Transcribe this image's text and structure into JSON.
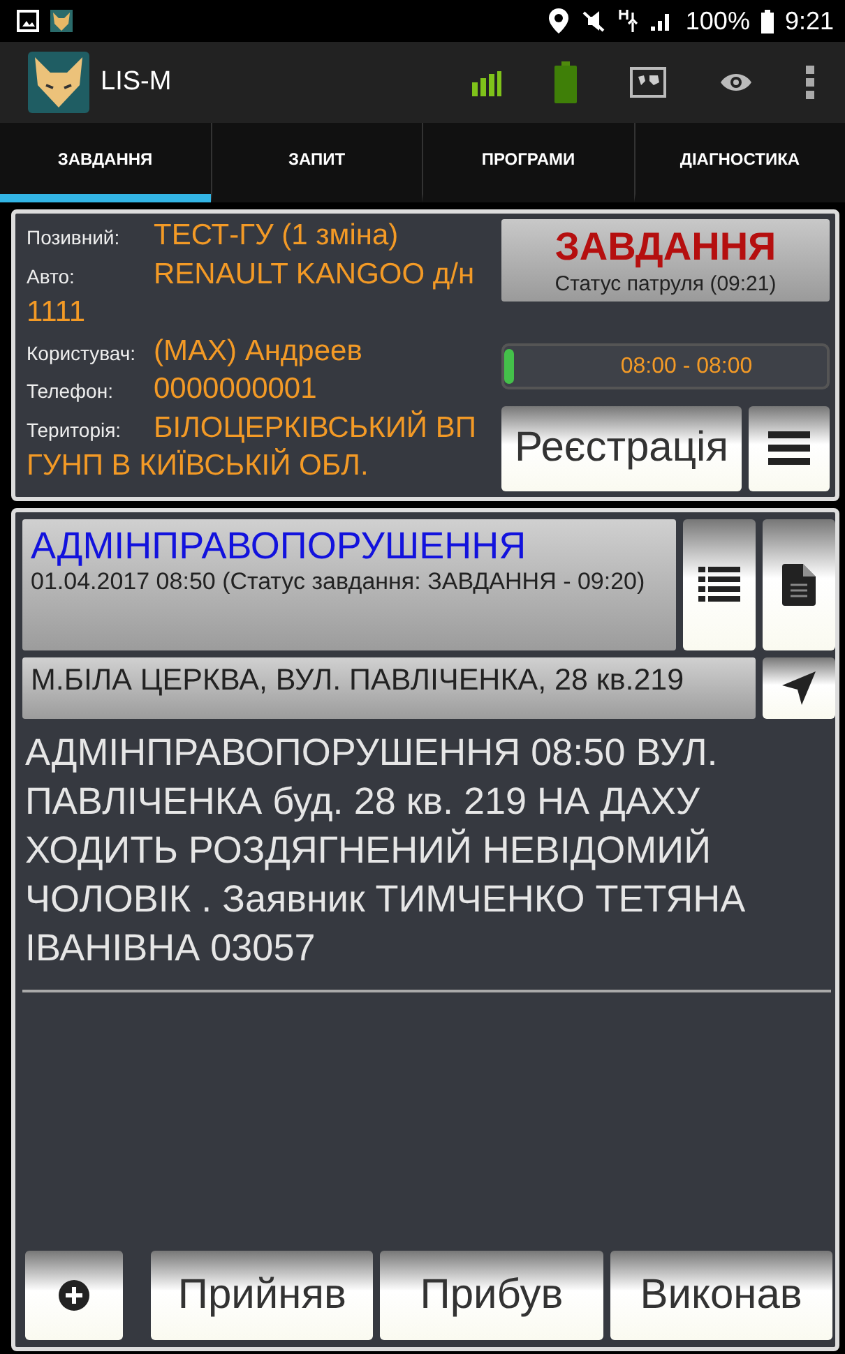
{
  "status_bar": {
    "battery": "100%",
    "time": "9:21"
  },
  "app_bar": {
    "title": "LIS-M"
  },
  "tabs": [
    {
      "label": "ЗАВДАННЯ",
      "selected": true
    },
    {
      "label": "ЗАПИТ",
      "selected": false
    },
    {
      "label": "ПРОГРАМИ",
      "selected": false
    },
    {
      "label": "ДІАГНОСТИКА",
      "selected": false
    }
  ],
  "patrol": {
    "fields": [
      {
        "label": "Позивний:",
        "value": "ТЕСТ-ГУ (1 зміна)"
      },
      {
        "label": "Авто:",
        "value": "RENAULT KANGOO д/н",
        "continuation": "1111"
      },
      {
        "label": "Користувач:",
        "value": "(MAX) Андреев"
      },
      {
        "label": "Телефон:",
        "value": "0000000001"
      },
      {
        "label": "Територія:",
        "value": "БІЛОЦЕРКІВСЬКИЙ ВП",
        "continuation": "ГУНП В КИЇВСЬКІЙ ОБЛ."
      }
    ],
    "status_button": {
      "title": "ЗАВДАННЯ",
      "subtitle": "Статус патруля (09:21)"
    },
    "shift": {
      "level": 0.03,
      "text": "08:00 - 08:00"
    },
    "register_button": "Реєстрація"
  },
  "task": {
    "title": "АДМІНПРАВОПОРУШЕННЯ",
    "subtitle": "01.04.2017 08:50 (Статус завдання: ЗАВДАННЯ - 09:20)",
    "address": "М.БІЛА ЦЕРКВА, ВУЛ. ПАВЛІЧЕНКА, 28 кв.219",
    "description": "АДМІНПРАВОПОРУШЕННЯ 08:50 ВУЛ. ПАВЛІЧЕНКА буд. 28 кв. 219 НА ДАХУ ХОДИТЬ РОЗДЯГНЕНИЙ НЕВІДОМИЙ ЧОЛОВІК . Заявник ТИМЧЕНКО ТЕТЯНА ІВАНІВНА 03057"
  },
  "actions": [
    "Прийняв",
    "Прибув",
    "Виконав"
  ]
}
